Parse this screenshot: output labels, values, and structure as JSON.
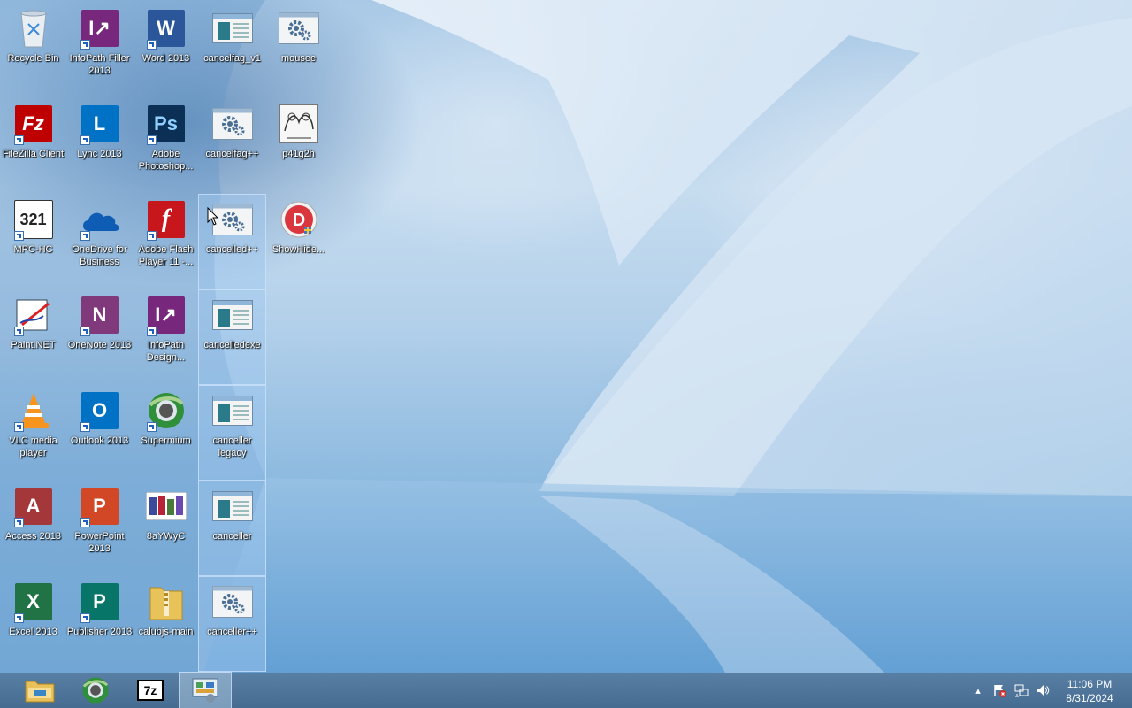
{
  "desktop": {
    "icons": [
      {
        "label": "Recycle Bin",
        "icon": "recycle-bin-icon"
      },
      {
        "label": "InfoPath Filler 2013",
        "icon": "infopath-filler-icon"
      },
      {
        "label": "Word 2013",
        "icon": "word-icon"
      },
      {
        "label": "cancelfag_v1",
        "icon": "application-window-icon"
      },
      {
        "label": "mousee",
        "icon": "gear-file-icon"
      },
      {
        "label": "FileZilla Client",
        "icon": "filezilla-icon"
      },
      {
        "label": "Lync 2013",
        "icon": "lync-icon"
      },
      {
        "label": "Adobe Photoshop...",
        "icon": "photoshop-icon"
      },
      {
        "label": "cancelfag++",
        "icon": "gear-file-icon"
      },
      {
        "label": "p41g2h",
        "icon": "image-thumbnail-icon"
      },
      {
        "label": "MPC-HC",
        "icon": "mpc-hc-icon"
      },
      {
        "label": "OneDrive for Business",
        "icon": "onedrive-icon"
      },
      {
        "label": "Adobe Flash Player 11 -...",
        "icon": "flash-player-icon"
      },
      {
        "label": "cancelled++",
        "icon": "gear-file-icon"
      },
      {
        "label": "ShowHide...",
        "icon": "showhide-icon"
      },
      {
        "label": "Paint.NET",
        "icon": "paintnet-icon"
      },
      {
        "label": "OneNote 2013",
        "icon": "onenote-icon"
      },
      {
        "label": "InfoPath Design...",
        "icon": "infopath-designer-icon"
      },
      {
        "label": "cancelledexe",
        "icon": "application-window-icon"
      },
      {
        "label": "VLC media player",
        "icon": "vlc-icon"
      },
      {
        "label": "Outlook 2013",
        "icon": "outlook-icon"
      },
      {
        "label": "Supermium",
        "icon": "supermium-icon"
      },
      {
        "label": "canceller legacy",
        "icon": "application-window-icon"
      },
      {
        "label": "Access 2013",
        "icon": "access-icon"
      },
      {
        "label": "PowerPoint 2013",
        "icon": "powerpoint-icon"
      },
      {
        "label": "8aYWyC",
        "icon": "image-thumbnail-icon"
      },
      {
        "label": "canceller",
        "icon": "application-window-icon"
      },
      {
        "label": "Excel 2013",
        "icon": "excel-icon"
      },
      {
        "label": "Publisher 2013",
        "icon": "publisher-icon"
      },
      {
        "label": "calubjs-main",
        "icon": "zip-folder-icon"
      },
      {
        "label": "canceller++",
        "icon": "gear-file-icon"
      }
    ]
  },
  "taskbar": {
    "pinned": [
      {
        "name": "file-explorer-icon"
      },
      {
        "name": "supermium-icon"
      },
      {
        "name": "7zip-icon",
        "text": "7z"
      },
      {
        "name": "control-panel-icon"
      }
    ],
    "tray": {
      "show_hidden": "▴",
      "icons": [
        "action-center-flag-icon",
        "network-icon",
        "volume-icon"
      ]
    },
    "clock": {
      "time": "11:06 PM",
      "date": "8/31/2024"
    }
  },
  "colors": {
    "office_word": "#2b579a",
    "office_excel": "#217346",
    "office_ppt": "#d24726",
    "office_onenote": "#80397b",
    "office_access": "#a4373a",
    "office_publisher": "#077568",
    "infopath": "#77287c"
  }
}
